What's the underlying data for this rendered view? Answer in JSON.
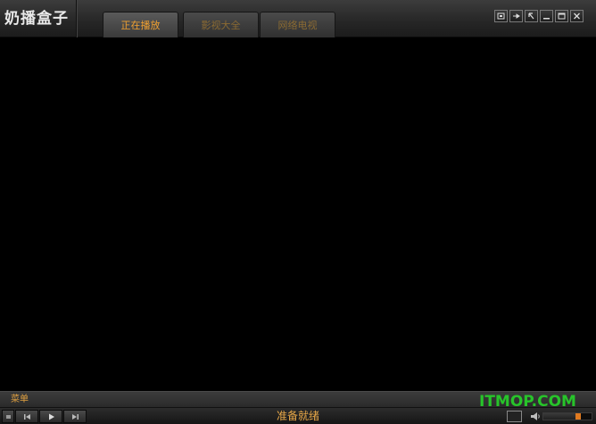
{
  "app": {
    "title": "奶播盒子"
  },
  "tabs": [
    {
      "label": "正在播放",
      "active": true
    },
    {
      "label": "影视大全",
      "active": false
    },
    {
      "label": "网络电视",
      "active": false
    }
  ],
  "window_controls": [
    "mini-mode-icon",
    "pin-icon",
    "restore-icon",
    "minimize-icon",
    "maximize-icon",
    "close-icon"
  ],
  "menu": {
    "label": "菜单"
  },
  "status": {
    "text": "准备就绪"
  },
  "watermark": {
    "text": "ITMOP.COM"
  },
  "volume": {
    "level": 0.72
  },
  "colors": {
    "accent": "#f0a030",
    "watermark": "#27c42a",
    "thumb": "#e07a20"
  }
}
